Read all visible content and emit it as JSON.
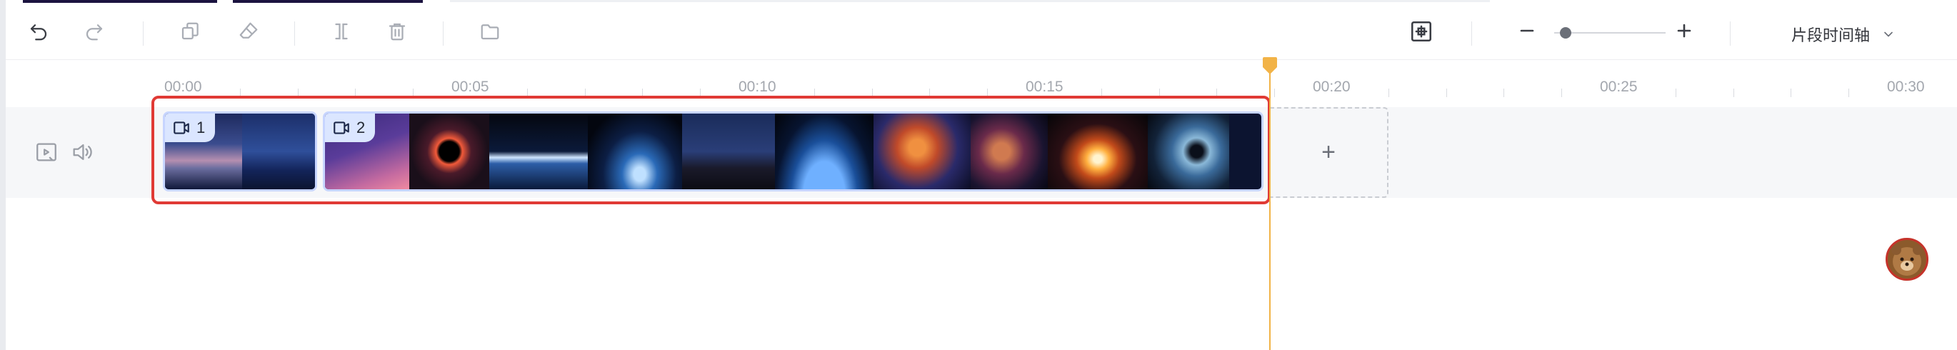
{
  "toolbar": {
    "undo": "undo-icon",
    "redo": "redo-icon",
    "copy": "copy-icon",
    "clear_format": "eraser-icon",
    "split": "split-icon",
    "delete": "trash-icon",
    "folder": "folder-icon",
    "smart_fit": "fit-frame-icon",
    "zoom_level": 0.05,
    "view_mode_label": "片段时间轴"
  },
  "ruler": {
    "ticks": [
      "00:00",
      "00:05",
      "00:10",
      "00:15",
      "00:20",
      "00:25",
      "00:30"
    ]
  },
  "track": {
    "controls": [
      "video-icon",
      "volume-icon"
    ],
    "clips": [
      {
        "index": "1",
        "icon": "video-clip-icon"
      },
      {
        "index": "2",
        "icon": "video-clip-icon"
      }
    ],
    "add_label": "+"
  },
  "playhead": {
    "time_seconds": 19.3
  },
  "colors": {
    "highlight_border": "#e03a35",
    "playhead": "#f2b347",
    "clip_border": "#c7d5ff",
    "badge_bg": "#dbe6ff"
  }
}
